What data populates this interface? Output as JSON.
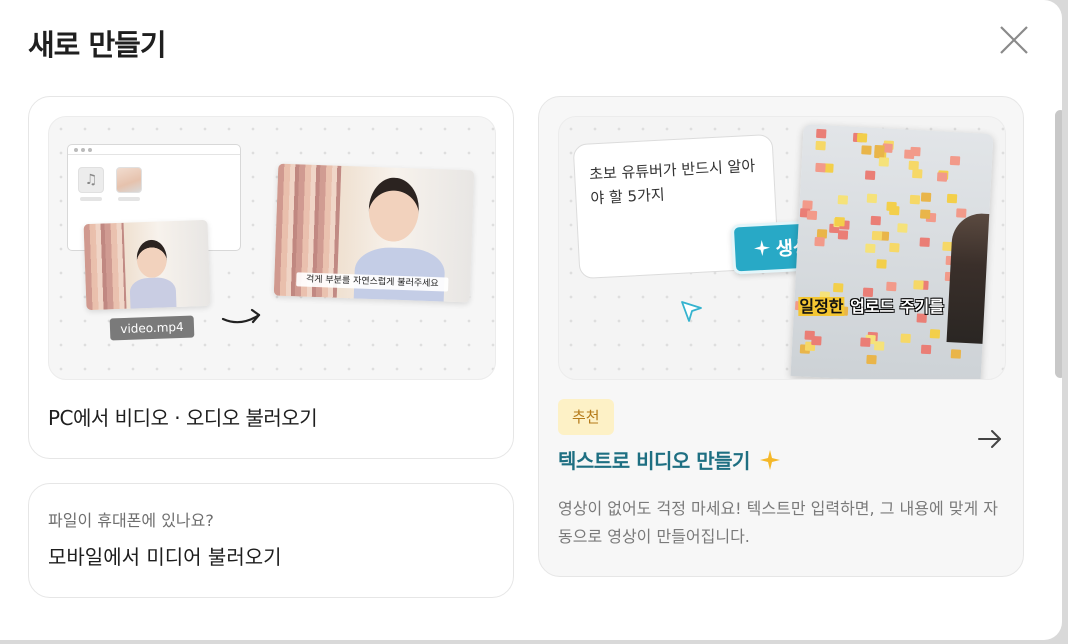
{
  "dialog": {
    "title": "새로 만들기"
  },
  "pc_card": {
    "label": "PC에서 비디오 · 오디오 불러오기",
    "file_name": "video.mp4",
    "subtitle_sample": "걱게 부분를 자연스럽게 불러주세요",
    "icon": "music-note-icon"
  },
  "mobile_card": {
    "subtitle": "파일이 휴대폰에 있나요?",
    "label": "모바일에서 미디어 불러오기"
  },
  "text_card": {
    "prompt_text": "초보 유튜버가 반드시 알아야 할 5가지",
    "generate_label": "생성",
    "caption_highlight": "일정한",
    "caption_rest": " 업로드 주기를",
    "badge": "추천",
    "title": "텍스트로 비디오 만들기",
    "description": "영상이 없어도 걱정 마세요! 텍스트만 입력하면, 그 내용에 맞게 자동으로 영상이 만들어집니다.",
    "colors": {
      "accent": "#28a9c6",
      "title": "#1e6f82",
      "badge_bg": "#fdf1c6",
      "badge_text": "#b57a18",
      "spark": "#f5b829"
    }
  }
}
